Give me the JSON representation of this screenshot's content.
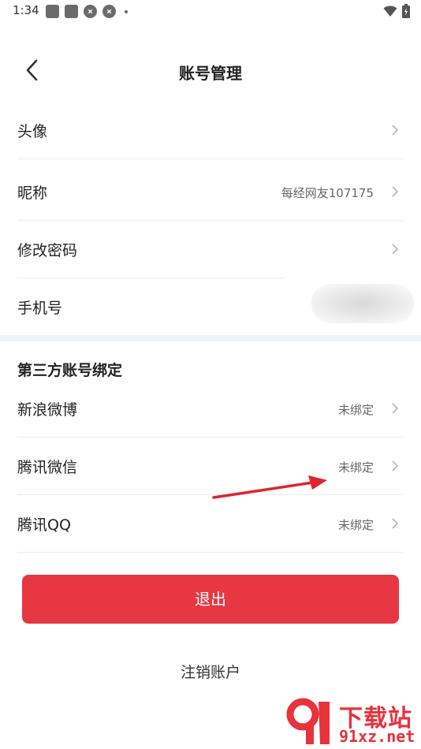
{
  "status_bar": {
    "time": "1:34",
    "icons": [
      "notification-square-icon",
      "notification-square-icon",
      "aperture-icon",
      "aperture-icon",
      "more-dot-icon",
      "wifi-icon",
      "battery-icon"
    ]
  },
  "header": {
    "title": "账号管理",
    "back_icon": "chevron-left-icon"
  },
  "profile_rows": [
    {
      "label": "头像",
      "value": ""
    },
    {
      "label": "昵称",
      "value": "每经网友107175"
    },
    {
      "label": "修改密码",
      "value": ""
    },
    {
      "label": "手机号",
      "value": ""
    }
  ],
  "third_party": {
    "title": "第三方账号绑定",
    "rows": [
      {
        "label": "新浪微博",
        "value": "未绑定"
      },
      {
        "label": "腾讯微信",
        "value": "未绑定"
      },
      {
        "label": "腾讯QQ",
        "value": "未绑定"
      }
    ]
  },
  "actions": {
    "logout_label": "退出",
    "cancel_account_label": "注销账户"
  },
  "watermark": {
    "title": "下载站",
    "url": "91xz.net"
  },
  "colors": {
    "accent": "#e63742",
    "divider": "#f0f4f8",
    "annotation_arrow": "#e0242c"
  }
}
